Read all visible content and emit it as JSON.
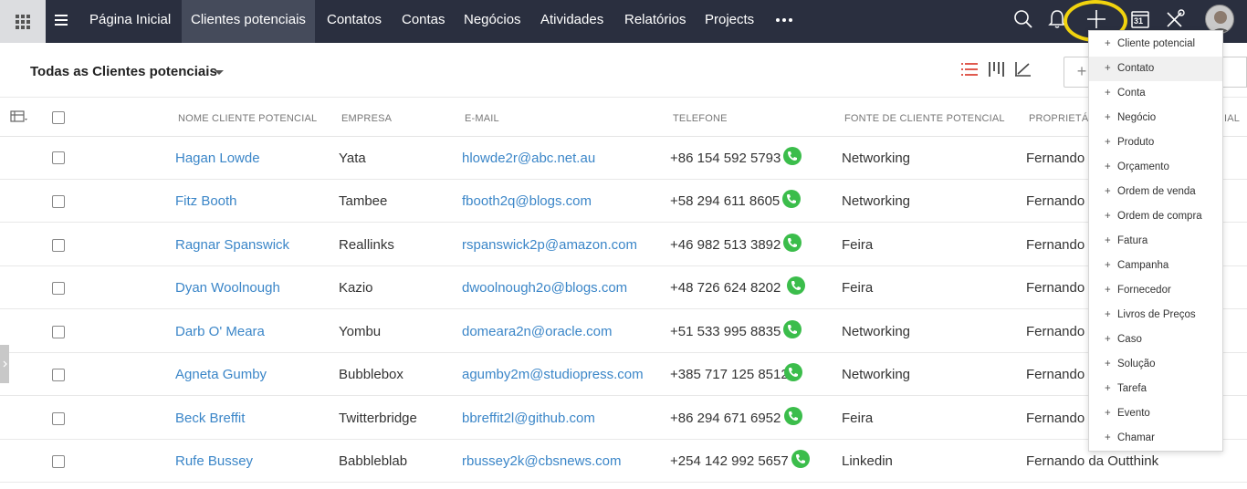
{
  "nav": {
    "items": [
      "Página Inicial",
      "Clientes potenciais",
      "Contatos",
      "Contas",
      "Negócios",
      "Atividades",
      "Relatórios",
      "Projects"
    ],
    "active_index": 1,
    "calendar_day": "31"
  },
  "subheader": {
    "view_title": "Todas as Clientes potenciais",
    "create_plus": "+"
  },
  "table": {
    "columns": [
      "NOME CLIENTE POTENCIAL",
      "EMPRESA",
      "E-MAIL",
      "TELEFONE",
      "FONTE DE CLIENTE POTENCIAL",
      "PROPRIETÁ",
      "IAL"
    ],
    "rows": [
      {
        "name": "Hagan Lowde",
        "company": "Yata",
        "email": "hlowde2r@abc.net.au",
        "phone": "+86 154 592 5793",
        "source": "Networking",
        "owner": "Fernando"
      },
      {
        "name": "Fitz Booth",
        "company": "Tambee",
        "email": "fbooth2q@blogs.com",
        "phone": "+58 294 611 8605",
        "source": "Networking",
        "owner": "Fernando"
      },
      {
        "name": "Ragnar Spanswick",
        "company": "Reallinks",
        "email": "rspanswick2p@amazon.com",
        "phone": "+46 982 513 3892",
        "source": "Feira",
        "owner": "Fernando"
      },
      {
        "name": "Dyan Woolnough",
        "company": "Kazio",
        "email": "dwoolnough2o@blogs.com",
        "phone": "+48 726 624 8202",
        "source": "Feira",
        "owner": "Fernando"
      },
      {
        "name": "Darb O' Meara",
        "company": "Yombu",
        "email": "domeara2n@oracle.com",
        "phone": "+51 533 995 8835",
        "source": "Networking",
        "owner": "Fernando"
      },
      {
        "name": "Agneta Gumby",
        "company": "Bubblebox",
        "email": "agumby2m@studiopress.com",
        "phone": "+385 717 125 8512",
        "source": "Networking",
        "owner": "Fernando"
      },
      {
        "name": "Beck Breffit",
        "company": "Twitterbridge",
        "email": "bbreffit2l@github.com",
        "phone": "+86 294 671 6952",
        "source": "Feira",
        "owner": "Fernando"
      },
      {
        "name": "Rufe Bussey",
        "company": "Babbleblab",
        "email": "rbussey2k@cbsnews.com",
        "phone": "+254 142 992 5657",
        "source": "Linkedin",
        "owner": "Fernando da Outthink"
      }
    ]
  },
  "create_menu": {
    "items": [
      "Cliente potencial",
      "Contato",
      "Conta",
      "Negócio",
      "Produto",
      "Orçamento",
      "Ordem de venda",
      "Ordem de compra",
      "Fatura",
      "Campanha",
      "Fornecedor",
      "Livros de Preços",
      "Caso",
      "Solução",
      "Tarefa",
      "Evento",
      "Chamar"
    ],
    "hovered_index": 1,
    "item_prefix": "+"
  },
  "colors": {
    "topbar": "#2a2f3f",
    "link": "#3b86c8",
    "phone_green": "#3bbd4b",
    "highlight": "#f1d30e",
    "list_view_active": "#e05a4f"
  }
}
